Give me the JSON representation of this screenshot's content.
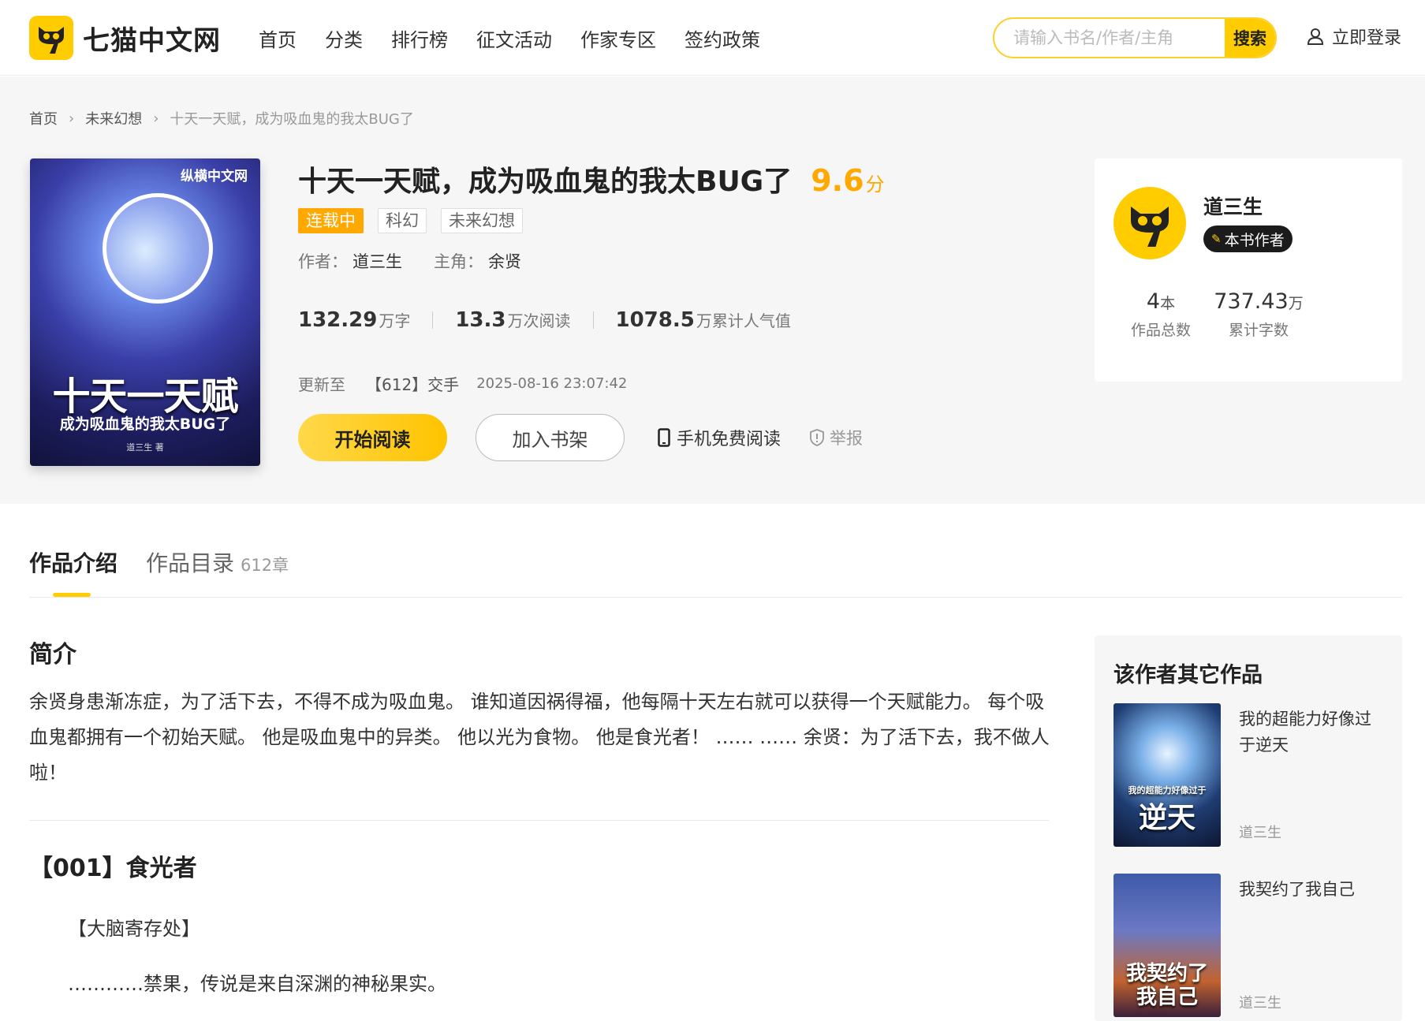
{
  "brand": {
    "name": "七猫中文网"
  },
  "nav": [
    "首页",
    "分类",
    "排行榜",
    "征文活动",
    "作家专区",
    "签约政策"
  ],
  "search": {
    "placeholder": "请输入书名/作者/主角",
    "button": "搜索"
  },
  "login": "立即登录",
  "breadcrumb": [
    "首页",
    "未来幻想",
    "十天一天赋，成为吸血鬼的我太BUG了"
  ],
  "book": {
    "title": "十天一天赋，成为吸血鬼的我太BUG了",
    "score": "9.6",
    "score_unit": "分",
    "tags": [
      "连载中",
      "科幻",
      "未来幻想"
    ],
    "author_label": "作者：",
    "author": "道三生",
    "protagonist_label": "主角：",
    "protagonist": "余贤",
    "stats": [
      {
        "n": "132.29",
        "u": "万字"
      },
      {
        "n": "13.3",
        "u": "万次阅读"
      },
      {
        "n": "1078.5",
        "u": "万累计人气值"
      }
    ],
    "update_label": "更新至",
    "update_chapter": "【612】交手",
    "update_time": "2025-08-16 23:07:42",
    "cover": {
      "publisher": "纵横中文网",
      "title": "十天一天赋",
      "subtitle": "成为吸血鬼的我太BUG了",
      "author": "道三生 著"
    }
  },
  "actions": {
    "read": "开始阅读",
    "shelf": "加入书架",
    "mobile": "手机免费阅读",
    "report": "举报"
  },
  "author_card": {
    "name": "道三生",
    "badge": "本书作者",
    "works_count": "4",
    "works_unit": "本",
    "works_label": "作品总数",
    "words_count": "737.43",
    "words_unit": "万",
    "words_label": "累计字数"
  },
  "tabs": [
    {
      "label": "作品介绍"
    },
    {
      "label": "作品目录",
      "count": "612章"
    }
  ],
  "intro": {
    "title": "简介",
    "text": "余贤身患渐冻症，为了活下去，不得不成为吸血鬼。 谁知道因祸得福，他每隔十天左右就可以获得一个天赋能力。 每个吸血鬼都拥有一个初始天赋。 他是吸血鬼中的异类。 他以光为食物。 他是食光者！ …… …… 余贤：为了活下去，我不做人啦！"
  },
  "chapter": {
    "title": "【001】食光者",
    "p1": "【大脑寄存处】",
    "p2": "…………禁果，传说是来自深渊的神秘果实。"
  },
  "sidebar": {
    "title": "该作者其它作品",
    "works": [
      {
        "title": "我的超能力好像过于逆天",
        "author": "道三生",
        "cover_small": "我的超能力好像过于",
        "cover_big": "逆天"
      },
      {
        "title": "我契约了我自己",
        "author": "道三生",
        "cover_big": "我契约了我自己"
      }
    ]
  },
  "colors": {
    "accent": "#ffcc00",
    "score": "#ffa800"
  }
}
